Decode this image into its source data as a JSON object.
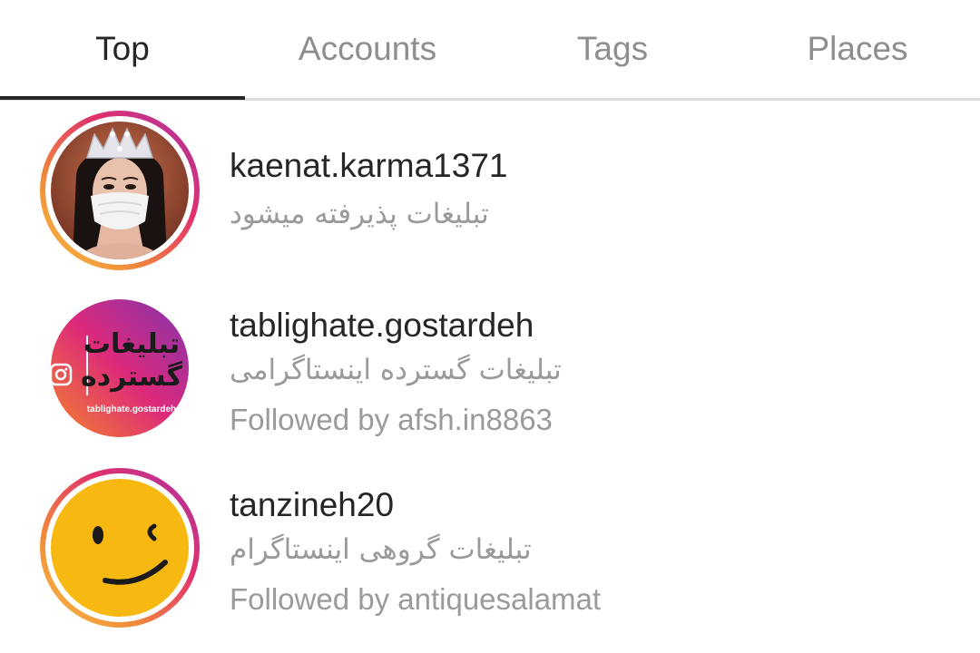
{
  "tabs": [
    {
      "label": "Top",
      "active": true
    },
    {
      "label": "Accounts",
      "active": false
    },
    {
      "label": "Tags",
      "active": false
    },
    {
      "label": "Places",
      "active": false
    }
  ],
  "results": [
    {
      "username": "kaenat.karma1371",
      "bio": "تبلیغات پذیرفته میشود",
      "followed_by": "",
      "avatar": "woman-with-crown-and-mask"
    },
    {
      "username": "tablighate.gostardeh",
      "bio": "تبلیغات گسترده اینستاگرامی",
      "followed_by": "Followed by afsh.in8863",
      "avatar": "logo",
      "avatar_text_line1": "تبلیغات",
      "avatar_text_line2": "گسترده",
      "avatar_caption": "tablighate.gostardeh"
    },
    {
      "username": "tanzineh20",
      "bio": "تبلیغات گروهی اینستاگرام",
      "followed_by": "Followed by antiquesalamat",
      "avatar": "winking-face"
    }
  ],
  "colors": {
    "active_text": "#262626",
    "inactive_text": "#8e8e8e",
    "secondary_text": "#9a9a9a",
    "story_ring": [
      "#f9c141",
      "#e1306c",
      "#a634a9"
    ]
  }
}
